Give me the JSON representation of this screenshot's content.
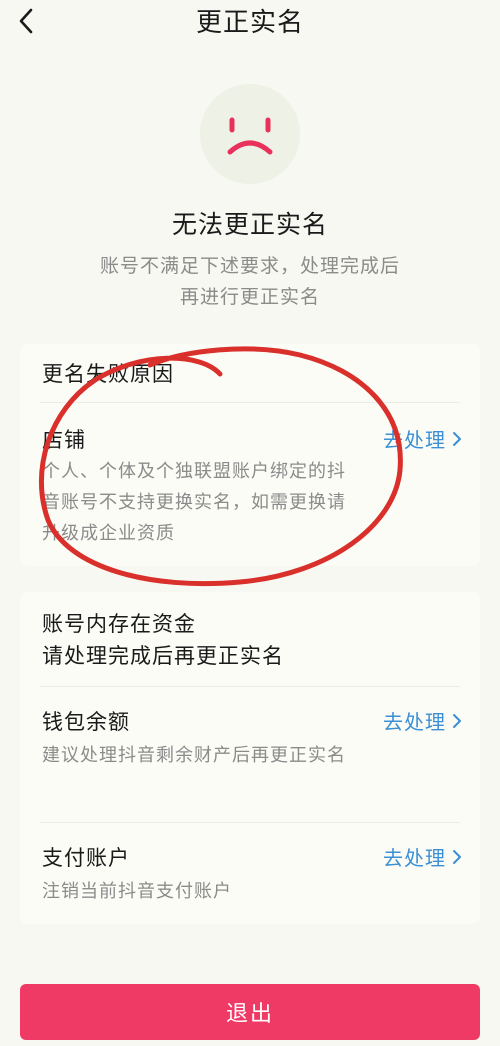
{
  "header": {
    "title": "更正实名",
    "back_icon": "chevron-left-icon"
  },
  "result": {
    "icon": "sad-face-icon",
    "title": "无法更正实名",
    "description": "账号不满足下述要求，处理完成后再进行更正实名"
  },
  "section1": {
    "title": "更名失败原因",
    "items": [
      {
        "title": "店铺",
        "description": "个人、个体及个独联盟账户绑定的抖音账号不支持更换实名，如需更换请升级成企业资质",
        "action": "去处理"
      }
    ]
  },
  "section2": {
    "title_line1": "账号内存在资金",
    "title_line2": "请处理完成后再更正实名",
    "items": [
      {
        "title": "钱包余额",
        "description": "建议处理抖音剩余财产后再更正实名",
        "action": "去处理"
      },
      {
        "title": "支付账户",
        "description": "注销当前抖音支付账户",
        "action": "去处理"
      }
    ]
  },
  "footer": {
    "exit_label": "退出"
  },
  "colors": {
    "accent": "#f03a66",
    "link": "#3c8fd4",
    "annotation": "#d9302c"
  }
}
